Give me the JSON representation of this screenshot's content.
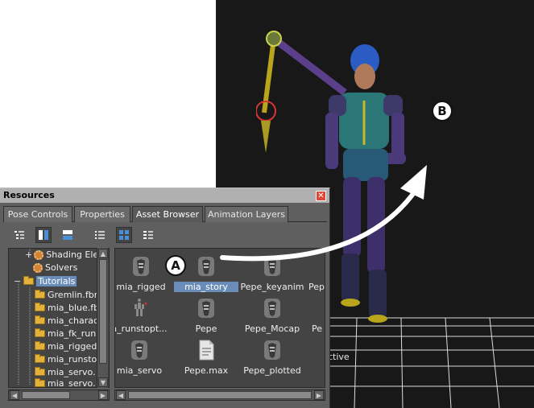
{
  "viewport": {
    "status_text": "ctive",
    "callout_b": "B"
  },
  "callout_a": "A",
  "panel": {
    "title": "Resources",
    "close_glyph": "✕",
    "tabs": [
      {
        "label": "Pose Controls",
        "active": false
      },
      {
        "label": "Properties",
        "active": false
      },
      {
        "label": "Asset Browser",
        "active": true
      },
      {
        "label": "Animation Layers",
        "active": false
      }
    ],
    "toolbar": [
      "tree-view-icon",
      "split-vertical-icon",
      "split-horizontal-icon",
      "list-view-icon",
      "icon-view-icon",
      "detail-view-icon"
    ],
    "tree": [
      {
        "label": "Shading Ele",
        "icon": "gear-icon",
        "expand": "+"
      },
      {
        "label": "Solvers",
        "icon": "gear-icon",
        "expand": ""
      },
      {
        "label": "Tutorials",
        "icon": "folder-icon",
        "expand": "−",
        "selected": true
      },
      {
        "label": "Gremlin.fbm",
        "icon": "folder-icon",
        "expand": ""
      },
      {
        "label": "mia_blue.fb",
        "icon": "folder-icon",
        "expand": ""
      },
      {
        "label": "mia_charac",
        "icon": "folder-icon",
        "expand": ""
      },
      {
        "label": "mia_fk_run",
        "icon": "folder-icon",
        "expand": ""
      },
      {
        "label": "mia_rigged",
        "icon": "folder-icon",
        "expand": ""
      },
      {
        "label": "mia_runsto",
        "icon": "folder-icon",
        "expand": ""
      },
      {
        "label": "mia_servo.",
        "icon": "folder-icon",
        "expand": ""
      },
      {
        "label": "mia_servo.",
        "icon": "folder-icon",
        "expand": ""
      }
    ],
    "assets": [
      {
        "label": "mia_rigged",
        "icon": "fbx-file-icon"
      },
      {
        "label": "mia_story",
        "icon": "fbx-file-icon",
        "selected": true
      },
      {
        "label": "Pepe_keyanim",
        "icon": "fbx-file-icon"
      },
      {
        "label": "Pep",
        "icon": "fbx-file-icon"
      },
      {
        "label": "a_runstopt...",
        "icon": "animation-preview-icon"
      },
      {
        "label": "Pepe",
        "icon": "fbx-file-icon"
      },
      {
        "label": "Pepe_Mocap",
        "icon": "fbx-file-icon"
      },
      {
        "label": "Pe",
        "icon": "fbx-file-icon"
      },
      {
        "label": "mia_servo",
        "icon": "fbx-file-icon"
      },
      {
        "label": "Pepe.max",
        "icon": "document-icon"
      },
      {
        "label": "Pepe_plotted",
        "icon": "fbx-file-icon"
      }
    ]
  },
  "colors": {
    "viewport_bg": "#181818",
    "panel_bg": "#5f5f5f",
    "selection": "#6a8cb8",
    "title_bar": "#b0b0b0",
    "close_red": "#e04535"
  }
}
